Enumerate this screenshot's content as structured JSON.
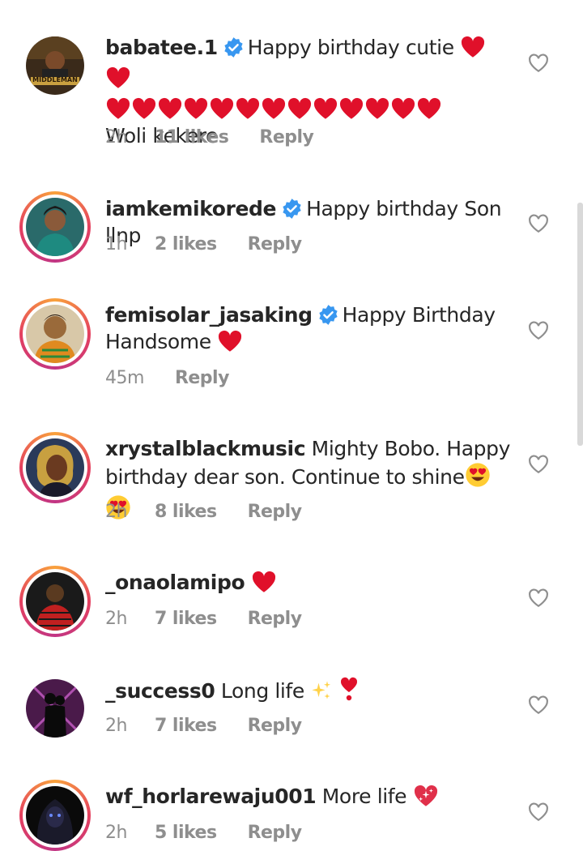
{
  "comments": [
    {
      "username": "babatee.1",
      "verified": true,
      "text_line1": "Happy birthday cutie",
      "text_line3": "Woli kekere",
      "time": "2h",
      "likes": "11 likes",
      "reply": "Reply",
      "avatar_text": "MIDDLEMAN"
    },
    {
      "username": "iamkemikorede",
      "verified": true,
      "text": "Happy birthday Son llnp",
      "time": "1h",
      "likes": "2 likes",
      "reply": "Reply"
    },
    {
      "username": "femisolar_jasaking",
      "verified": true,
      "text_line1": "Happy Birthday",
      "text_line2": "Handsome",
      "time": "45m",
      "reply": "Reply"
    },
    {
      "username": "xrystalblackmusic",
      "verified": false,
      "text_line1": "Mighty Bobo. Happy",
      "text_line2": "birthday dear son. Continue to shine",
      "time": "2h",
      "likes": "8 likes",
      "reply": "Reply"
    },
    {
      "username": "_onaolamipo",
      "verified": false,
      "text": "",
      "time": "2h",
      "likes": "7 likes",
      "reply": "Reply"
    },
    {
      "username": "_success0",
      "verified": false,
      "text": "Long life",
      "time": "2h",
      "likes": "7 likes",
      "reply": "Reply"
    },
    {
      "username": "wf_horlarewaju001",
      "verified": false,
      "text": "More life",
      "time": "2h",
      "likes": "5 likes",
      "reply": "Reply"
    }
  ],
  "colors": {
    "heart": "#e0102a",
    "verified": "#3897f0",
    "muted": "#8e8e8e"
  }
}
